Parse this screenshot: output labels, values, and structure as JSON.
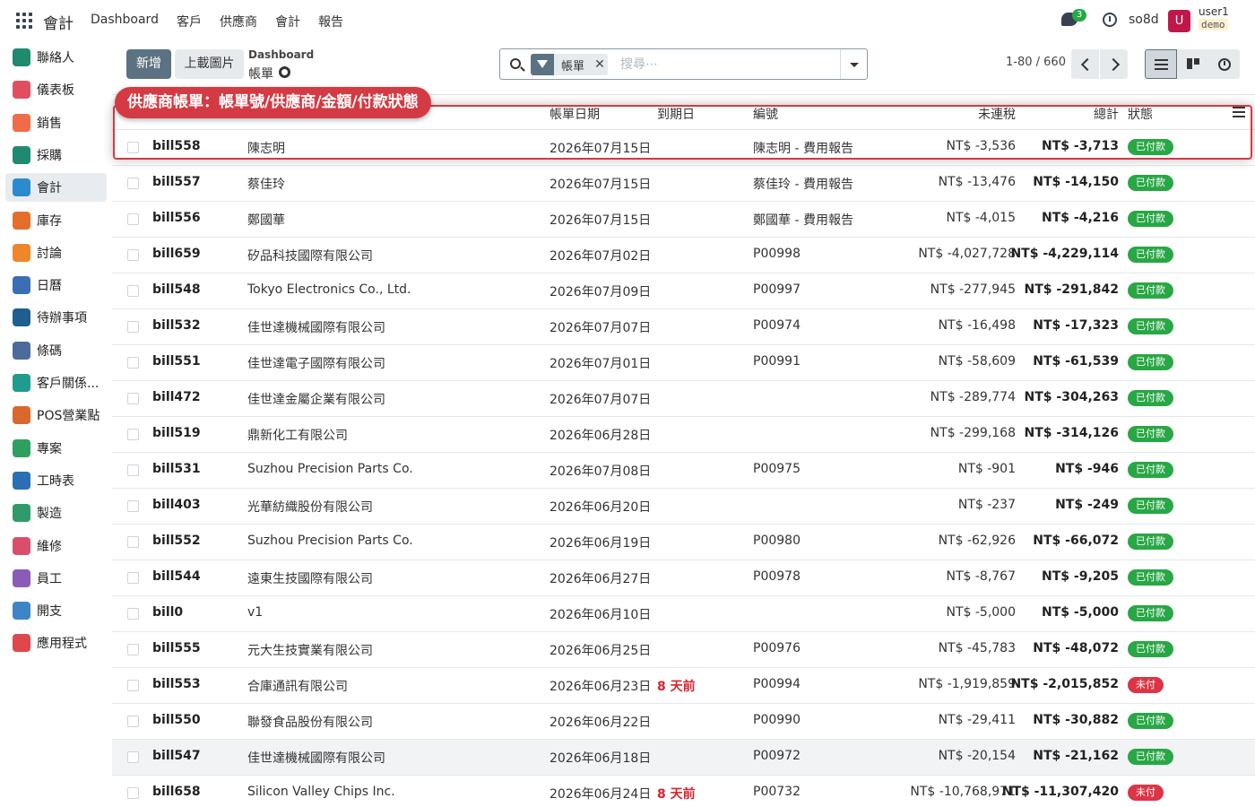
{
  "topbar": {
    "app_name": "會計",
    "menu": [
      "Dashboard",
      "客戶",
      "供應商",
      "會計",
      "報告"
    ],
    "chat_count": "3",
    "company": "so8d",
    "avatar_letter": "U",
    "username": "user1",
    "database": "demo"
  },
  "sidebar": {
    "items": [
      {
        "label": "聯絡人",
        "color": "#1f8a70"
      },
      {
        "label": "儀表板",
        "color": "#e04f5f"
      },
      {
        "label": "銷售",
        "color": "#f06b48"
      },
      {
        "label": "採購",
        "color": "#1f8a70"
      },
      {
        "label": "會計",
        "color": "#2a8ccf"
      },
      {
        "label": "庫存",
        "color": "#e66e2d"
      },
      {
        "label": "討論",
        "color": "#f0862a"
      },
      {
        "label": "日曆",
        "color": "#3b6fb5"
      },
      {
        "label": "待辦事項",
        "color": "#1f5f8f"
      },
      {
        "label": "條碼",
        "color": "#4c6b9a"
      },
      {
        "label": "客戶關係...",
        "color": "#1f9c8f"
      },
      {
        "label": "POS營業點",
        "color": "#d9682b"
      },
      {
        "label": "專案",
        "color": "#2da05f"
      },
      {
        "label": "工時表",
        "color": "#2a6fb3"
      },
      {
        "label": "製造",
        "color": "#2f9b6b"
      },
      {
        "label": "維修",
        "color": "#d94f6b"
      },
      {
        "label": "員工",
        "color": "#8a5cb8"
      },
      {
        "label": "開支",
        "color": "#3d85c6"
      },
      {
        "label": "應用程式",
        "color": "#e0474c"
      }
    ],
    "active_index": 4
  },
  "control": {
    "new_label": "新增",
    "upload_label": "上載圖片",
    "breadcrumb_parent": "Dashboard",
    "breadcrumb_current": "帳單",
    "facet_label": "帳單",
    "search_placeholder": "搜尋⋯",
    "pager": "1-80 / 660"
  },
  "annotation": "供應商帳單：帳單號/供應商/金額/付款狀態",
  "table": {
    "headers": {
      "bill_date": "帳單日期",
      "due_date": "到期日",
      "reference": "編號",
      "untaxed": "未連稅",
      "total": "總計",
      "status": "狀態"
    },
    "rows": [
      {
        "number": "bill558",
        "partner": "陳志明",
        "date": "2026年07月15日",
        "due": "",
        "ref": "陳志明 - 費用報告",
        "untaxed": "NT$ -3,536",
        "total": "NT$ -3,713",
        "status": "已付款",
        "paid": true
      },
      {
        "number": "bill557",
        "partner": "蔡佳玲",
        "date": "2026年07月15日",
        "due": "",
        "ref": "蔡佳玲 - 費用報告",
        "untaxed": "NT$ -13,476",
        "total": "NT$ -14,150",
        "status": "已付款",
        "paid": true
      },
      {
        "number": "bill556",
        "partner": "鄭國華",
        "date": "2026年07月15日",
        "due": "",
        "ref": "鄭國華 - 費用報告",
        "untaxed": "NT$ -4,015",
        "total": "NT$ -4,216",
        "status": "已付款",
        "paid": true
      },
      {
        "number": "bill659",
        "partner": "矽品科技國際有限公司",
        "date": "2026年07月02日",
        "due": "",
        "ref": "P00998",
        "untaxed": "NT$ -4,027,728",
        "total": "NT$ -4,229,114",
        "status": "已付款",
        "paid": true
      },
      {
        "number": "bill548",
        "partner": "Tokyo Electronics Co., Ltd.",
        "date": "2026年07月09日",
        "due": "",
        "ref": "P00997",
        "untaxed": "NT$ -277,945",
        "total": "NT$ -291,842",
        "status": "已付款",
        "paid": true
      },
      {
        "number": "bill532",
        "partner": "佳世達機械國際有限公司",
        "date": "2026年07月07日",
        "due": "",
        "ref": "P00974",
        "untaxed": "NT$ -16,498",
        "total": "NT$ -17,323",
        "status": "已付款",
        "paid": true
      },
      {
        "number": "bill551",
        "partner": "佳世達電子國際有限公司",
        "date": "2026年07月01日",
        "due": "",
        "ref": "P00991",
        "untaxed": "NT$ -58,609",
        "total": "NT$ -61,539",
        "status": "已付款",
        "paid": true
      },
      {
        "number": "bill472",
        "partner": "佳世達金屬企業有限公司",
        "date": "2026年07月07日",
        "due": "",
        "ref": "",
        "untaxed": "NT$ -289,774",
        "total": "NT$ -304,263",
        "status": "已付款",
        "paid": true
      },
      {
        "number": "bill519",
        "partner": "鼎新化工有限公司",
        "date": "2026年06月28日",
        "due": "",
        "ref": "",
        "untaxed": "NT$ -299,168",
        "total": "NT$ -314,126",
        "status": "已付款",
        "paid": true
      },
      {
        "number": "bill531",
        "partner": "Suzhou Precision Parts Co.",
        "date": "2026年07月08日",
        "due": "",
        "ref": "P00975",
        "untaxed": "NT$ -901",
        "total": "NT$ -946",
        "status": "已付款",
        "paid": true
      },
      {
        "number": "bill403",
        "partner": "光華紡織股份有限公司",
        "date": "2026年06月20日",
        "due": "",
        "ref": "",
        "untaxed": "NT$ -237",
        "total": "NT$ -249",
        "status": "已付款",
        "paid": true
      },
      {
        "number": "bill552",
        "partner": "Suzhou Precision Parts Co.",
        "date": "2026年06月19日",
        "due": "",
        "ref": "P00980",
        "untaxed": "NT$ -62,926",
        "total": "NT$ -66,072",
        "status": "已付款",
        "paid": true
      },
      {
        "number": "bill544",
        "partner": "遠東生技國際有限公司",
        "date": "2026年06月27日",
        "due": "",
        "ref": "P00978",
        "untaxed": "NT$ -8,767",
        "total": "NT$ -9,205",
        "status": "已付款",
        "paid": true
      },
      {
        "number": "bill0",
        "partner": "v1",
        "date": "2026年06月10日",
        "due": "",
        "ref": "",
        "untaxed": "NT$ -5,000",
        "total": "NT$ -5,000",
        "status": "已付款",
        "paid": true
      },
      {
        "number": "bill555",
        "partner": "元大生技實業有限公司",
        "date": "2026年06月25日",
        "due": "",
        "ref": "P00976",
        "untaxed": "NT$ -45,783",
        "total": "NT$ -48,072",
        "status": "已付款",
        "paid": true
      },
      {
        "number": "bill553",
        "partner": "合庫通訊有限公司",
        "date": "2026年06月23日",
        "due": "8 天前",
        "ref": "P00994",
        "untaxed": "NT$ -1,919,859",
        "total": "NT$ -2,015,852",
        "status": "未付",
        "paid": false
      },
      {
        "number": "bill550",
        "partner": "聯發食品股份有限公司",
        "date": "2026年06月22日",
        "due": "",
        "ref": "P00990",
        "untaxed": "NT$ -29,411",
        "total": "NT$ -30,882",
        "status": "已付款",
        "paid": true
      },
      {
        "number": "bill547",
        "partner": "佳世達機械國際有限公司",
        "date": "2026年06月18日",
        "due": "",
        "ref": "P00972",
        "untaxed": "NT$ -20,154",
        "total": "NT$ -21,162",
        "status": "已付款",
        "paid": true
      },
      {
        "number": "bill658",
        "partner": "Silicon Valley Chips Inc.",
        "date": "2026年06月24日",
        "due": "8 天前",
        "ref": "P00732",
        "untaxed": "NT$ -10,768,971",
        "total": "NT$ -11,307,420",
        "status": "未付",
        "paid": false
      }
    ],
    "highlighted_row": 17
  }
}
